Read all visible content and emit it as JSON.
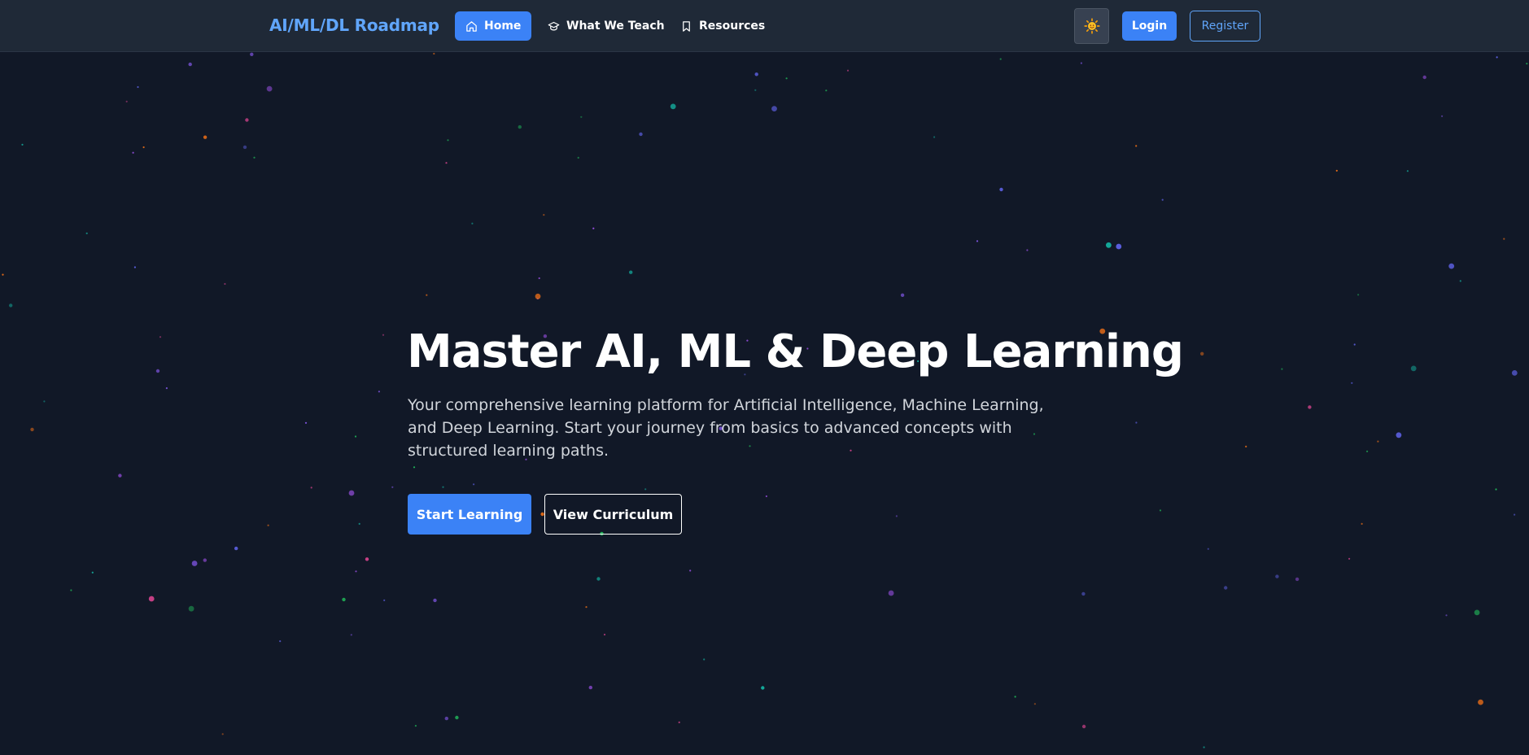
{
  "header": {
    "brand": "AI/ML/DL Roadmap",
    "nav": [
      {
        "label": "Home",
        "icon": "home-icon",
        "active": true
      },
      {
        "label": "What We Teach",
        "icon": "graduation-cap-icon",
        "active": false
      },
      {
        "label": "Resources",
        "icon": "bookmark-icon",
        "active": false
      }
    ],
    "theme_toggle_icon": "sun-icon",
    "login_label": "Login",
    "register_label": "Register"
  },
  "hero": {
    "title": "Master AI, ML & Deep Learning",
    "subtitle": "Your comprehensive learning platform for Artificial Intelligence, Machine Learning, and Deep Learning. Start your journey from basics to advanced concepts with structured learning paths.",
    "primary_cta": "Start Learning",
    "secondary_cta": "View Curriculum"
  },
  "colors": {
    "background": "#111827",
    "navbar": "#1f2937",
    "accent": "#3b82f6",
    "accent_text": "#60a5fa",
    "particles": [
      "#8b5cf6",
      "#22c55e",
      "#ec4899",
      "#14b8a6",
      "#6366f1",
      "#f97316",
      "#a855f7"
    ]
  }
}
